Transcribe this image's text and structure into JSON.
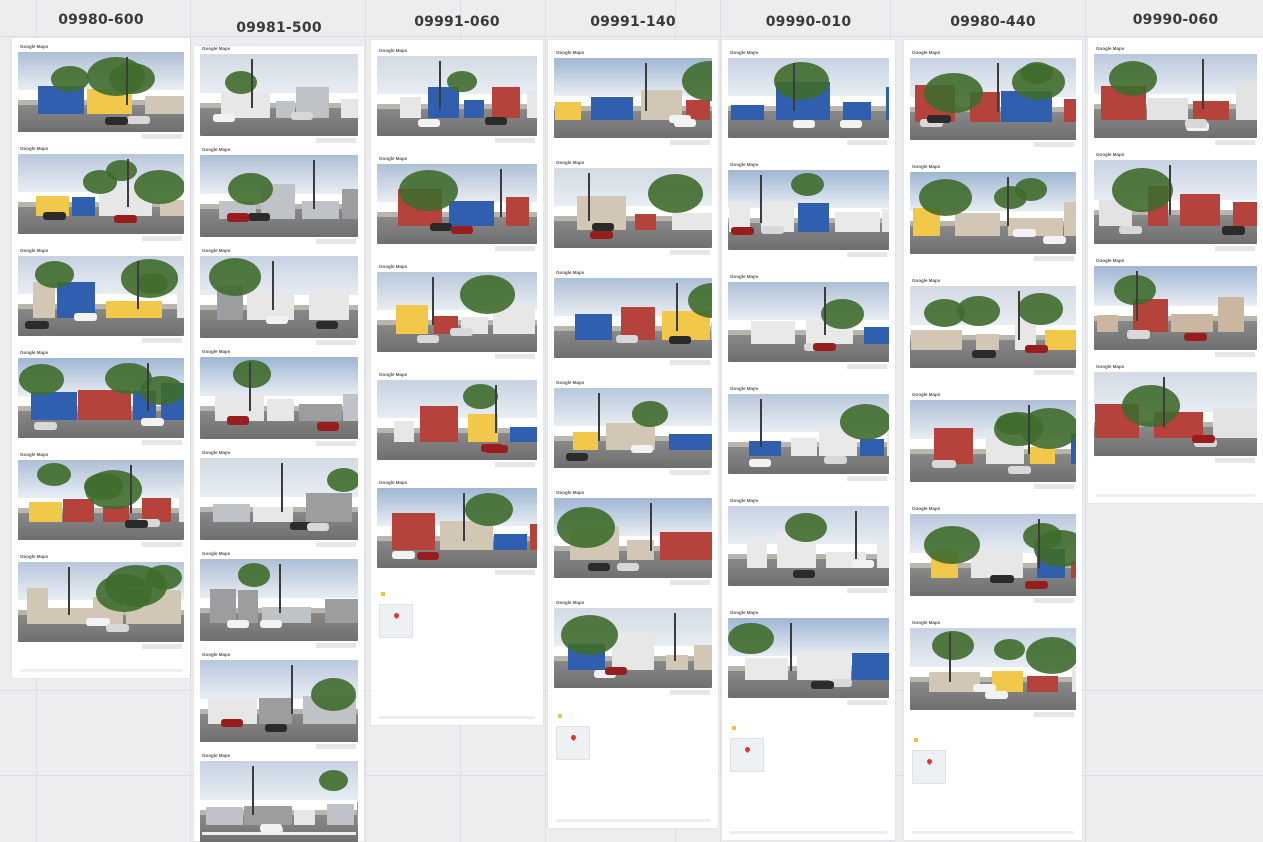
{
  "columns": [
    {
      "title": "09980-600",
      "header": "Google Maps",
      "views": 6
    },
    {
      "title": "09981-500",
      "header": "Google Maps",
      "views": 8
    },
    {
      "title": "09991-060",
      "header": "Google Maps",
      "views": 5
    },
    {
      "title": "09991-140",
      "header": "Google Maps",
      "views": 6
    },
    {
      "title": "09990-010",
      "header": "Google Maps",
      "views": 6
    },
    {
      "title": "09980-440",
      "header": "Google Maps",
      "views": 6
    },
    {
      "title": "09990-060",
      "header": "Google Maps",
      "views": 4
    }
  ],
  "palette": {
    "background": "#ecedef",
    "sheet": "#ffffff",
    "title_text": "#3a3a3a",
    "sky": "#aebfd6",
    "asphalt": "#6f6f70",
    "tree": "#3f6b2c",
    "building_white": "#e7e7e7",
    "building_blue": "#2f5fae",
    "building_red": "#b5433b",
    "pin": "#e5352b"
  }
}
